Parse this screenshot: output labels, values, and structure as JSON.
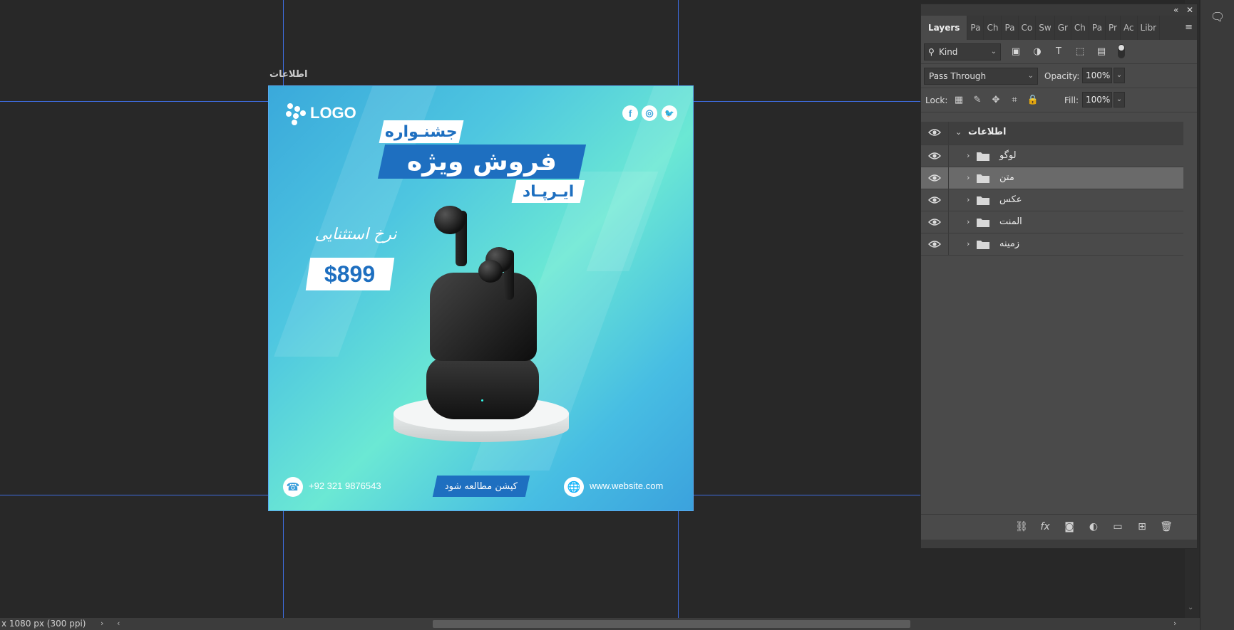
{
  "canvas": {
    "artboard_label": "اطلاعات"
  },
  "poster": {
    "logo_text": "LOGO",
    "social": {
      "facebook": "f",
      "instagram": "◎",
      "twitter": "🐦"
    },
    "tag_festival": "جشنـواره",
    "tag_special_sale": "فروش ویژه",
    "tag_airpod": "ایـرپـاد",
    "price_label": "نرخ استثنایی",
    "price": "$899",
    "phone": "+92 321 9876543",
    "caption": "کپشن مطالعه شود",
    "website": "www.website.com"
  },
  "panel": {
    "tabs": [
      "Layers",
      "Pa",
      "Ch",
      "Pa",
      "Co",
      "Sw",
      "Gr",
      "Ch",
      "Pa",
      "Pr",
      "Ac",
      "Libr"
    ],
    "filter_kind": "Kind",
    "blend_mode": "Pass Through",
    "opacity_label": "Opacity:",
    "opacity_value": "100%",
    "lock_label": "Lock:",
    "fill_label": "Fill:",
    "fill_value": "100%",
    "layers": [
      {
        "name": "اطلاعات",
        "type": "group-head",
        "selected": false
      },
      {
        "name": "لوگو",
        "type": "group",
        "selected": false
      },
      {
        "name": "متن",
        "type": "group",
        "selected": true
      },
      {
        "name": "عکس",
        "type": "group",
        "selected": false
      },
      {
        "name": "المنت",
        "type": "group",
        "selected": false
      },
      {
        "name": "زمینه",
        "type": "group",
        "selected": false
      }
    ]
  },
  "status": {
    "doc_info": "x 1080 px (300 ppi)"
  },
  "colors": {
    "accent_blue": "#1e6fc0",
    "guide": "#3e6de0",
    "panel_bg": "#4a4a4a",
    "selected_row": "#6a6a6a"
  }
}
